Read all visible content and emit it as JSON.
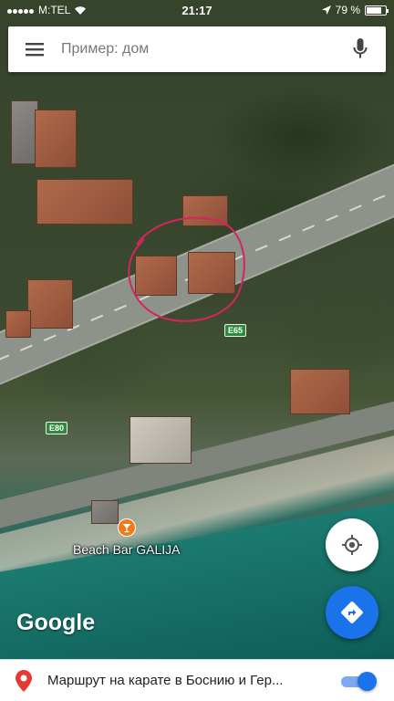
{
  "status_bar": {
    "carrier": "M:TEL",
    "time": "21:17",
    "battery": "79 %",
    "battery_level": 0.79
  },
  "search": {
    "menu_icon": "hamburger-menu-icon",
    "placeholder": "Пример: дом",
    "mic_icon": "microphone-icon"
  },
  "map": {
    "road_labels": [
      "E65",
      "E80"
    ],
    "place_label": "Beach Bar GALIJA",
    "place_icon": "cocktail-icon",
    "attribution": "Google",
    "colors": {
      "circle": "#d6245f",
      "place_pin": "#f07a1a",
      "shield": "#2e8a3e"
    }
  },
  "buttons": {
    "my_location_icon": "my-location-icon",
    "directions_icon": "directions-icon",
    "directions_color": "#1a73e8"
  },
  "bottom_bar": {
    "pin_icon": "maps-pin-icon",
    "text": "Маршрут на карате в Боснию и Гер...",
    "toggle_on": true
  }
}
